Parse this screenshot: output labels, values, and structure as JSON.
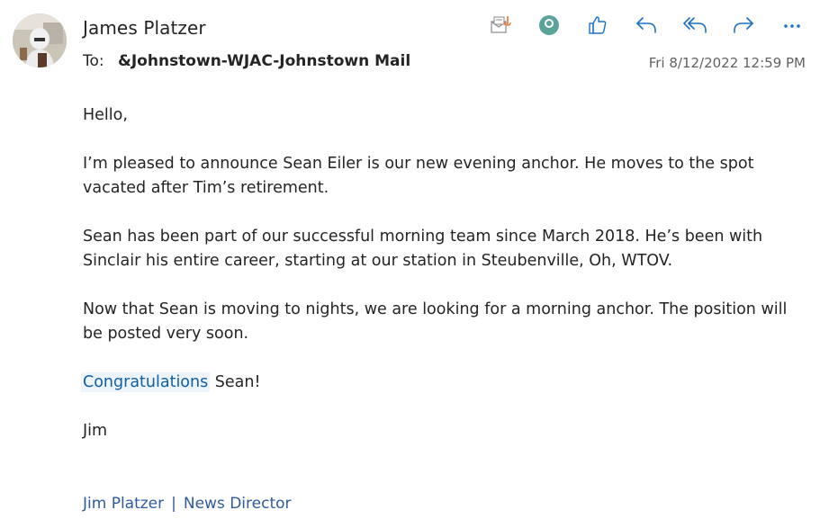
{
  "sender": {
    "name": "James Platzer"
  },
  "recipient": {
    "label": "To:",
    "value": "&Johnstown-WJAC-Johnstown Mail"
  },
  "sent_date": "Fri 8/12/2022 12:59 PM",
  "toolbar": {
    "icons": [
      "report-icon",
      "presence-icon",
      "like-icon",
      "reply-icon",
      "reply-all-icon",
      "forward-icon",
      "more-icon"
    ]
  },
  "body": {
    "greeting": "Hello,",
    "p1": "I’m pleased to announce Sean Eiler is our new evening anchor.  He moves to the spot vacated after Tim’s retirement.",
    "p2": "Sean has been part of our successful morning team since March 2018.  He’s been with Sinclair his entire career, starting at our station in Steubenville, Oh, WTOV.",
    "p3": "Now that Sean is moving to nights, we are looking for a morning anchor.  The position will be posted very soon.",
    "congrats_word": "Congratulations",
    "congrats_rest": " Sean!",
    "closing": "Jim"
  },
  "signature": {
    "name": "Jim Platzer",
    "separator": "|",
    "title": "News Director"
  },
  "colors": {
    "accent": "#115ea3",
    "presence": "#5aa39a",
    "text": "#242424",
    "muted": "#616161"
  }
}
